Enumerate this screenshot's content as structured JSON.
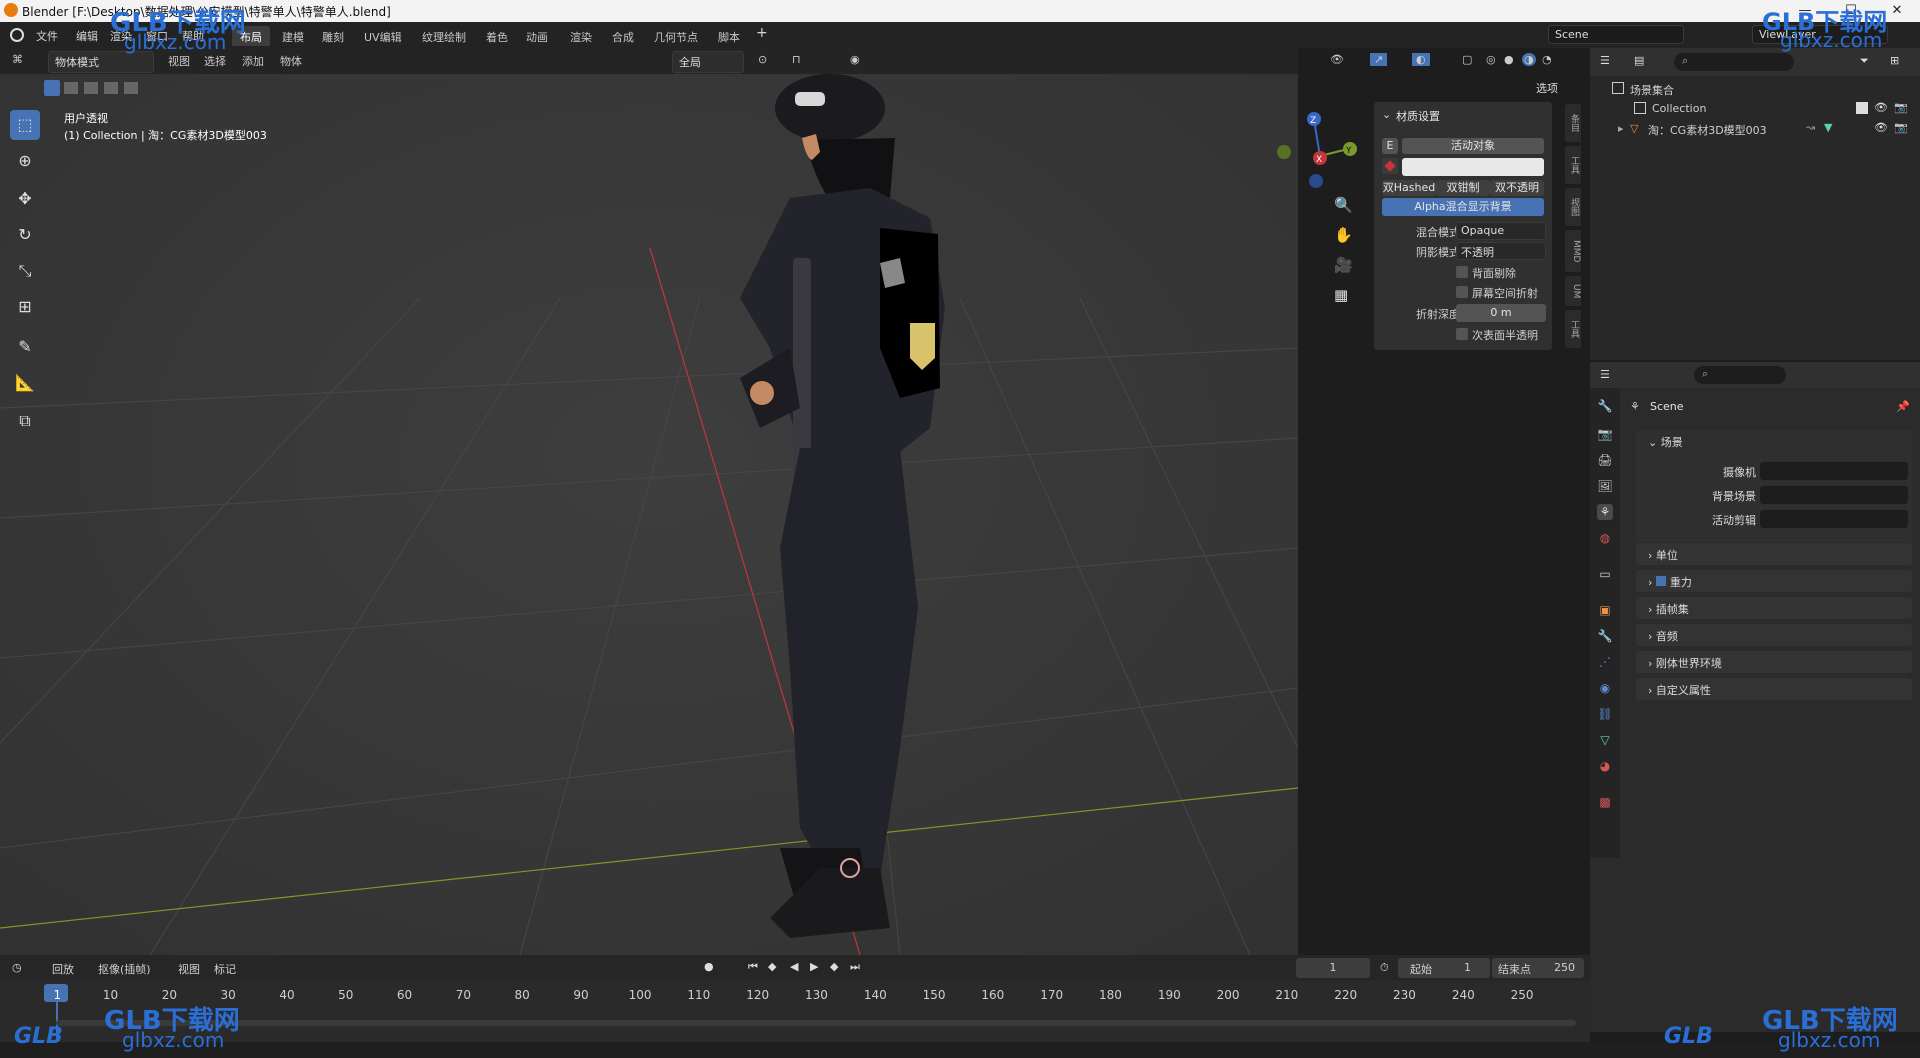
{
  "window": {
    "title": "Blender [F:\\Desktop\\数据处理\\公安模型\\特警单人\\特警单人.blend]"
  },
  "menu": [
    "文件",
    "编辑",
    "渲染",
    "窗口",
    "帮助"
  ],
  "workspaces": [
    "布局",
    "建模",
    "雕刻",
    "UV编辑",
    "纹理绘制",
    "着色",
    "动画",
    "渲染",
    "合成",
    "几何节点",
    "脚本"
  ],
  "scene_field": "Scene",
  "viewlayer_field": "ViewLayer",
  "viewport_header": {
    "mode": "物体模式",
    "view": "视图",
    "select": "选择",
    "add": "添加",
    "object": "物体",
    "transform": "全局",
    "options": "选项"
  },
  "viewport_overlay": {
    "view_name": "用户透视",
    "collection_info": "(1) Collection | 淘：CG素材3D模型003"
  },
  "gizmo": {
    "z": "Z",
    "y": "Y",
    "x": "X"
  },
  "material_panel": {
    "title": "材质设置",
    "slot_key": "E",
    "active_object": "活动对象",
    "tabs": [
      "双Hashed",
      "双钳制",
      "双不透明"
    ],
    "alpha_button": "Alpha混合显示背景",
    "blend_mode_label": "混合模式",
    "blend_mode_value": "Opaque",
    "shadow_mode_label": "阴影模式",
    "shadow_mode_value": "不透明",
    "backface": "背面剔除",
    "screen_refraction": "屏幕空间折射",
    "refraction_depth_label": "折射深度",
    "refraction_depth_value": "0 m",
    "subsurface": "次表面半透明"
  },
  "side_tabs": [
    "条目",
    "工具",
    "视图",
    "MMD",
    "UM",
    "工具"
  ],
  "outliner": {
    "root": "场景集合",
    "items": [
      {
        "label": "Collection"
      },
      {
        "label": "淘：CG素材3D模型003"
      }
    ]
  },
  "properties": {
    "scene_name": "Scene",
    "section_title": "场景",
    "fields": [
      {
        "label": "摄像机"
      },
      {
        "label": "背景场景"
      },
      {
        "label": "活动剪辑"
      }
    ],
    "sections": [
      "单位",
      "重力",
      "插帧集",
      "音频",
      "刚体世界环境",
      "自定义属性"
    ]
  },
  "timeline": {
    "menus": [
      "回放",
      "抠像(插帧)",
      "视图",
      "标记"
    ],
    "current_frame": "1",
    "start_label": "起始",
    "start_value": "1",
    "end_label": "结束点",
    "end_value": "250",
    "ticks": [
      "1",
      "10",
      "20",
      "30",
      "40",
      "50",
      "60",
      "70",
      "80",
      "90",
      "100",
      "110",
      "120",
      "130",
      "140",
      "150",
      "160",
      "170",
      "180",
      "190",
      "200",
      "210",
      "220",
      "230",
      "240",
      "250"
    ]
  },
  "watermarks": {
    "brand": "GLB下载网",
    "site": "glbxz.com",
    "logo": "GLB"
  },
  "colors": {
    "accent": "#4772b3",
    "x_axis": "#c5353a",
    "y_axis": "#7a9a2a",
    "z_axis": "#3a66c8"
  }
}
